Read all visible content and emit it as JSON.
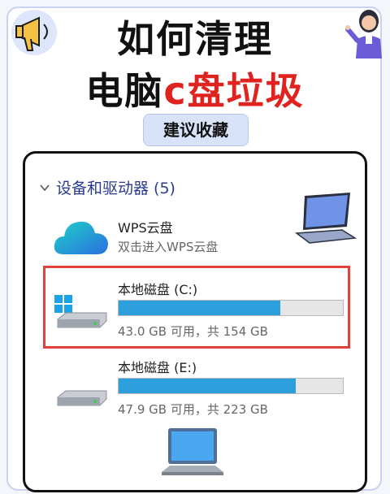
{
  "header": {
    "title_line1": "如何清理",
    "title_line2_prefix": "电脑",
    "title_line2_highlight": "c盘垃圾",
    "badge": "建议收藏",
    "accent_red": "#e0231e",
    "accent_blue": "#2d9fdd"
  },
  "explorer": {
    "section_title": "设备和驱动器 (5)",
    "items": [
      {
        "icon": "wps-cloud-icon",
        "name": "WPS云盘",
        "subtitle": "双击进入WPS云盘"
      },
      {
        "icon": "windows-drive-icon",
        "name": "本地磁盘 (C:)",
        "usage_text": "43.0 GB 可用，共 154 GB",
        "used_fraction": 0.72,
        "highlighted": true
      },
      {
        "icon": "drive-icon",
        "name": "本地磁盘 (E:)",
        "usage_text": "47.9 GB 可用，共 223 GB",
        "used_fraction": 0.79,
        "highlighted": false
      }
    ]
  }
}
